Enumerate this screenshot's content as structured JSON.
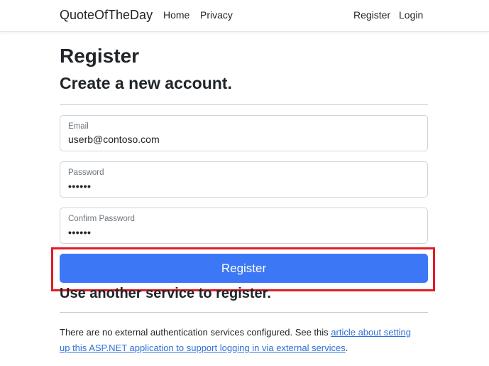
{
  "navbar": {
    "brand": "QuoteOfTheDay",
    "links": {
      "home": "Home",
      "privacy": "Privacy",
      "register": "Register",
      "login": "Login"
    }
  },
  "page": {
    "title": "Register",
    "subtitle": "Create a new account."
  },
  "form": {
    "email": {
      "label": "Email",
      "value": "userb@contoso.com"
    },
    "password": {
      "label": "Password",
      "masked_value": "••••••"
    },
    "confirm_password": {
      "label": "Confirm Password",
      "masked_value": "••••••"
    },
    "submit_label": "Register"
  },
  "external": {
    "heading": "Use another service to register.",
    "text": "There are no external authentication services configured. See this ",
    "link_text": "article about setting up this ASP.NET application to support logging in via external services",
    "text_end": "."
  },
  "colors": {
    "button": "#3c78f6",
    "highlight": "#e01c24",
    "link": "#2f6fd6"
  }
}
